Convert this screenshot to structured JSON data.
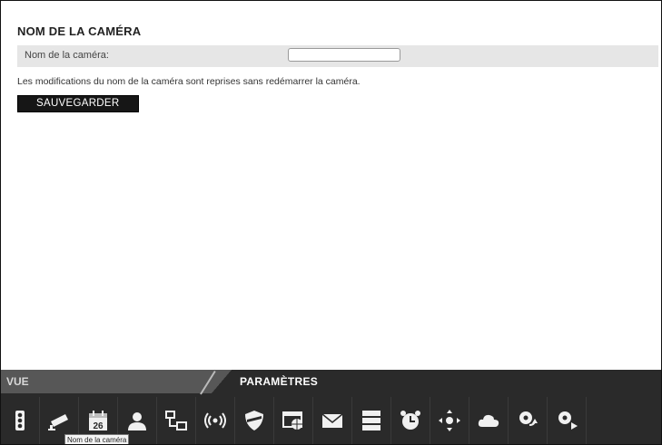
{
  "section_title": "NOM DE LA CAMÉRA",
  "form": {
    "name_label": "Nom de la caméra:",
    "name_value": "",
    "note": "Les modifications du nom de la caméra sont reprises sans redémarrer la caméra.",
    "save_label": "SAUVEGARDER"
  },
  "tabs": {
    "vue": "VUE",
    "parametres": "PARAMÈTRES"
  },
  "toolbar": {
    "tooltip": "Nom de la caméra",
    "calendar_day": "26",
    "icons": [
      "traffic-light-icon",
      "camera-icon",
      "calendar-icon",
      "user-icon",
      "network-icon",
      "wireless-icon",
      "shield-icon",
      "web-icon",
      "mail-icon",
      "server-icon",
      "alarm-clock-icon",
      "ptz-icon",
      "cloud-icon",
      "gear-refresh-icon",
      "gear-arrow-icon"
    ]
  }
}
